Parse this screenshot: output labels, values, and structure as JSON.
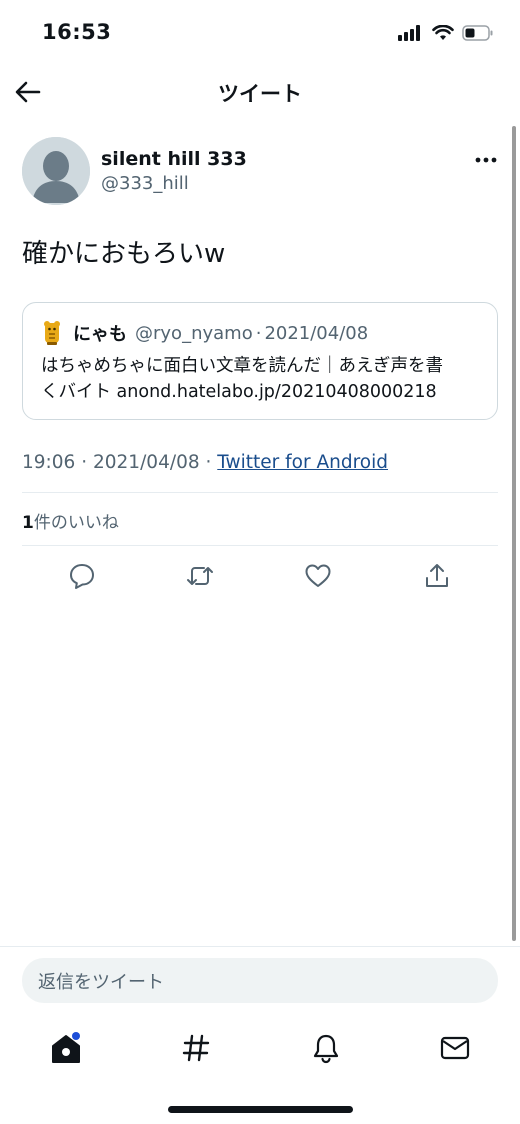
{
  "status_bar": {
    "time": "16:53"
  },
  "nav": {
    "title": "ツイート"
  },
  "tweet": {
    "author_name": "silent hill 333",
    "author_handle": "@333_hill",
    "text": "確かにおもろいw",
    "quote": {
      "name": "にゃも",
      "handle": "@ryo_nyamo",
      "dot": "·",
      "date": "2021/04/08",
      "body_line1": "はちゃめちゃに面白い文章を読んだ｜あえぎ声を書",
      "body_line2": "くバイト anond.hatelabo.jp/20210408000218"
    },
    "meta": {
      "time": "19:06",
      "sep1": " · ",
      "date": "2021/04/08",
      "sep2": " · ",
      "client": "Twitter for Android"
    },
    "likes": {
      "count": "1",
      "label": "件のいいね"
    }
  },
  "reply": {
    "placeholder": "返信をツイート"
  },
  "icons": {
    "back": "arrow-left-icon",
    "more": "more-icon",
    "reply": "reply-icon",
    "retweet": "retweet-icon",
    "like": "heart-icon",
    "share": "share-icon",
    "home": "home-icon",
    "explore": "hashtag-icon",
    "notifications": "bell-icon",
    "messages": "mail-icon"
  },
  "colors": {
    "text": "#0f1419",
    "secondary": "#536471",
    "link": "#1a4d8c",
    "badge": "#1d4ed8"
  }
}
